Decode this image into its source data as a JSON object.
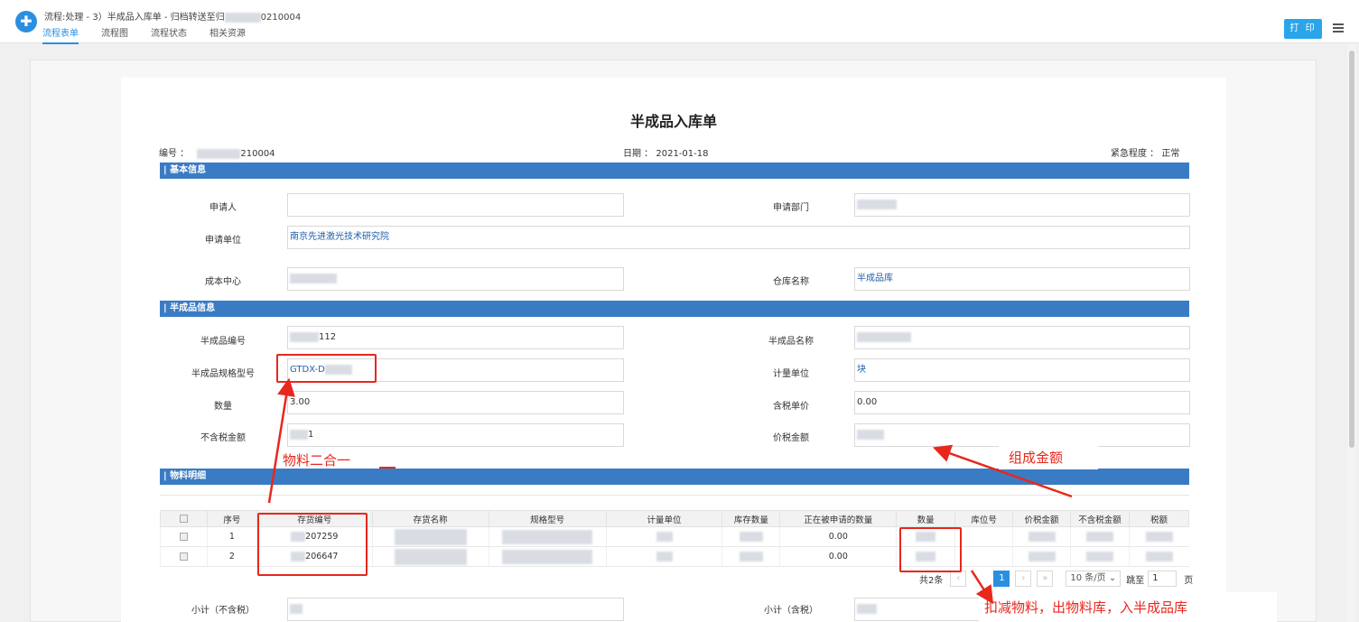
{
  "window": {
    "title": "流程:处理 - 3）半成品入库单 - 归档转送至归",
    "title_suffix": "0210004",
    "tabs": [
      "流程表单",
      "流程图",
      "流程状态",
      "相关资源"
    ],
    "print_label": "打 印"
  },
  "doc": {
    "title": "半成品入库单",
    "number_label": "编号 ：",
    "number_suffix": "210004",
    "date_label": "日期 ：",
    "date_value": "2021-01-18",
    "urgency_label": "紧急程度 ：",
    "urgency_value": "正常"
  },
  "sections": {
    "basic": "基本信息",
    "product": "半成品信息",
    "materials": "物料明细"
  },
  "basic": {
    "applicant_label": "申请人",
    "applicant_value": "",
    "dept_label": "申请部门",
    "unit_label": "申请单位",
    "unit_value": "南京先进激光技术研究院",
    "cost_center_label": "成本中心",
    "warehouse_label": "仓库名称",
    "warehouse_value": "半成品库"
  },
  "product": {
    "code_label": "半成品编号",
    "code_value": "112",
    "name_label": "半成品名称",
    "spec_label": "半成品规格型号",
    "spec_value": "GTDX-D",
    "unit_label": "计量单位",
    "unit_value": "块",
    "qty_label": "数量",
    "qty_value": "3.00",
    "tax_price_label": "含税单价",
    "tax_price_value": "0.00",
    "notax_amount_label": "不含税金额",
    "notax_amount_value": "1",
    "total_label": "价税金额"
  },
  "table": {
    "headers": [
      "序号",
      "存货编号",
      "存货名称",
      "规格型号",
      "计量单位",
      "库存数量",
      "正在被申请的数量",
      "数量",
      "库位号",
      "价税金额",
      "不含税金额",
      "税额"
    ],
    "rows": [
      {
        "seq": "1",
        "code": "207259",
        "pending": "0.00"
      },
      {
        "seq": "2",
        "code": "206647",
        "pending": "0.00"
      }
    ]
  },
  "pager": {
    "total": "共2条",
    "prev": "‹",
    "current": "1",
    "next": "›",
    "last": "»",
    "size": "10 条/页",
    "jump_label": "跳至",
    "jump_value": "1",
    "page_unit": "页"
  },
  "subtotal": {
    "notax_label": "小计（不含税）",
    "tax_label": "小计（含税）"
  },
  "annotations": {
    "merge": "物料二合一",
    "amount": "组成金额",
    "deduct": "扣减物料，出物料库，入半成品库"
  },
  "colors": {
    "accent": "#2b8fe0",
    "section": "#3a7cc4",
    "annotation": "#e8271d"
  }
}
